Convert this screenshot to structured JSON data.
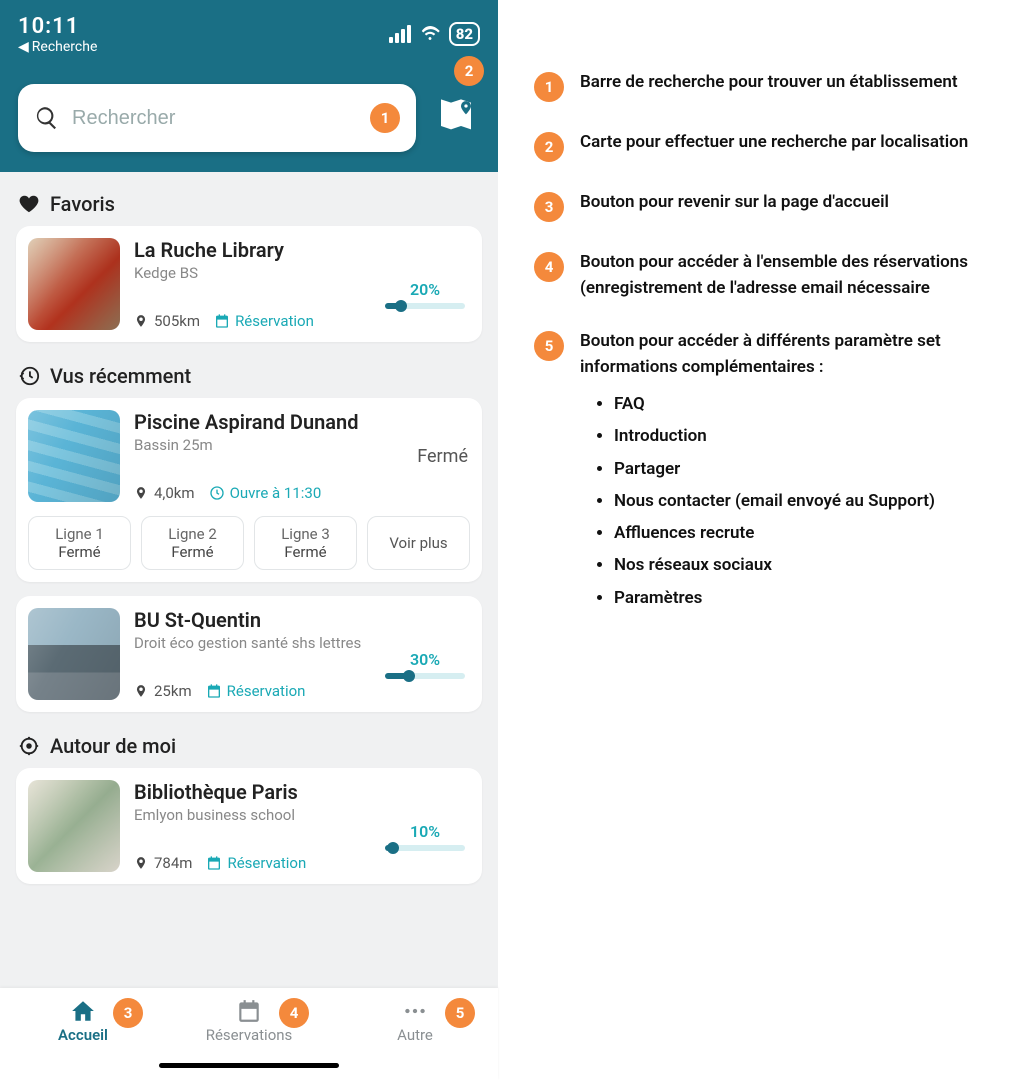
{
  "statusbar": {
    "time": "10:11",
    "back_label": "Recherche",
    "battery": "82"
  },
  "search": {
    "placeholder": "Rechercher"
  },
  "annotations": {
    "n1": "1",
    "n2": "2",
    "n3": "3",
    "n4": "4",
    "n5": "5"
  },
  "sections": {
    "favorites": "Favoris",
    "recent": "Vus récemment",
    "around": "Autour de moi"
  },
  "cards": {
    "fav1": {
      "title": "La Ruche Library",
      "subtitle": "Kedge BS",
      "distance": "505km",
      "reservation_label": "Réservation",
      "pct": "20%"
    },
    "rec1": {
      "title": "Piscine Aspirand Dunand",
      "subtitle": "Bassin 25m",
      "closed": "Fermé",
      "distance": "4,0km",
      "opens": "Ouvre à 11:30",
      "lanes": {
        "l1a": "Ligne 1",
        "l1b": "Fermé",
        "l2a": "Ligne 2",
        "l2b": "Fermé",
        "l3a": "Ligne 3",
        "l3b": "Fermé",
        "more": "Voir plus"
      }
    },
    "rec2": {
      "title": "BU St-Quentin",
      "subtitle": "Droit éco gestion santé shs lettres",
      "distance": "25km",
      "reservation_label": "Réservation",
      "pct": "30%"
    },
    "around1": {
      "title": "Bibliothèque Paris",
      "subtitle": "Emlyon business school",
      "distance": "784m",
      "reservation_label": "Réservation",
      "pct": "10%"
    }
  },
  "bottomnav": {
    "home": "Accueil",
    "reservations": "Réservations",
    "other": "Autre"
  },
  "legend": {
    "i1": "Barre de recherche pour trouver un établissement",
    "i2": "Carte pour effectuer une recherche par localisation",
    "i3": "Bouton pour revenir sur la page d'accueil",
    "i4": "Bouton pour accéder à l'ensemble des réservations (enregistrement de l'adresse email nécessaire",
    "i5": "Bouton pour accéder à différents paramètre set informations complémentaires :",
    "bullets": {
      "b1": "FAQ",
      "b2": "Introduction",
      "b3": "Partager",
      "b4": "Nous contacter (email envoyé au Support)",
      "b5": "Affluences recrute",
      "b6": "Nos réseaux sociaux",
      "b7": "Paramètres"
    }
  }
}
